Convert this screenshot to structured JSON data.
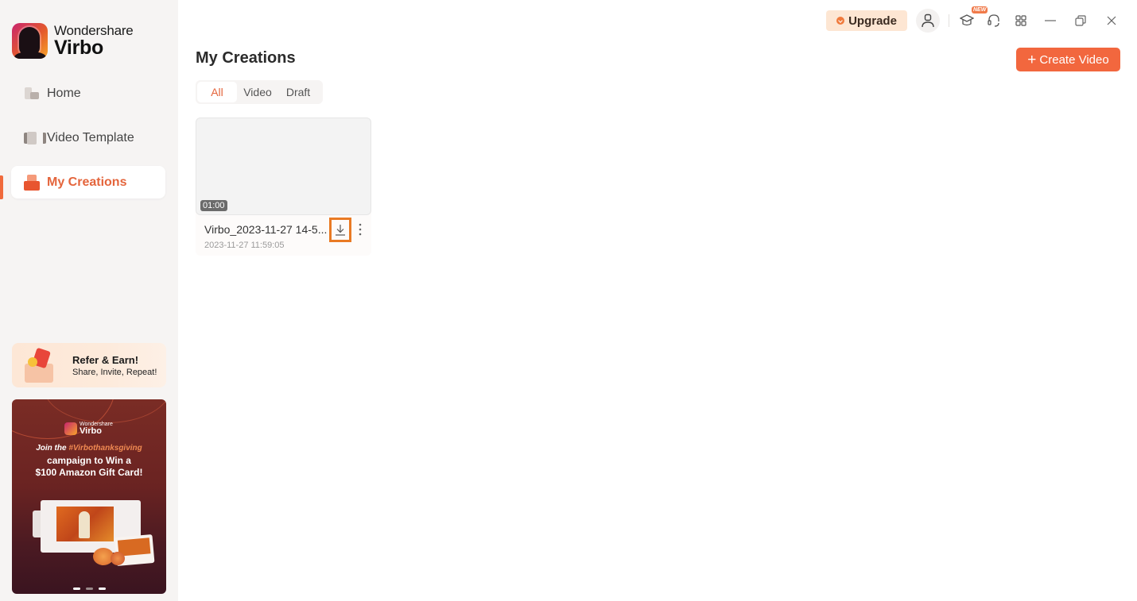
{
  "app": {
    "brand": "Wondershare",
    "product": "Virbo"
  },
  "sidebar": {
    "items": [
      {
        "label": "Home",
        "icon": "home-icon",
        "active": false
      },
      {
        "label": "Video Template",
        "icon": "video-template-icon",
        "active": false
      },
      {
        "label": "My Creations",
        "icon": "my-creations-icon",
        "active": true
      }
    ],
    "refer": {
      "title": "Refer & Earn!",
      "subtitle": "Share, Invite, Repeat!"
    },
    "promo": {
      "brand": "Wondershare",
      "product": "Virbo",
      "line1_prefix": "Join the ",
      "line1_hashtag": "#Virbothanksgiving",
      "line2": "campaign to Win a",
      "line3": "$100 Amazon Gift Card!",
      "slides": 3,
      "active_slide": 1
    }
  },
  "topbar": {
    "upgrade_label": "Upgrade",
    "new_badge": "NEW",
    "icons": [
      "user-icon",
      "tutorial-icon",
      "support-icon",
      "apps-icon",
      "minimize-icon",
      "restore-icon",
      "close-icon"
    ]
  },
  "main": {
    "title": "My Creations",
    "create_button": "Create Video",
    "tabs": [
      {
        "label": "All",
        "active": true
      },
      {
        "label": "Video",
        "active": false
      },
      {
        "label": "Draft",
        "active": false
      }
    ],
    "creations": [
      {
        "name": "Virbo_2023-11-27 14-5...",
        "date": "2023-11-27 11:59:05",
        "duration": "01:00"
      }
    ]
  },
  "colors": {
    "accent": "#f2673e",
    "highlight": "#e97a24",
    "sidebar_bg": "#f6f4f3"
  }
}
